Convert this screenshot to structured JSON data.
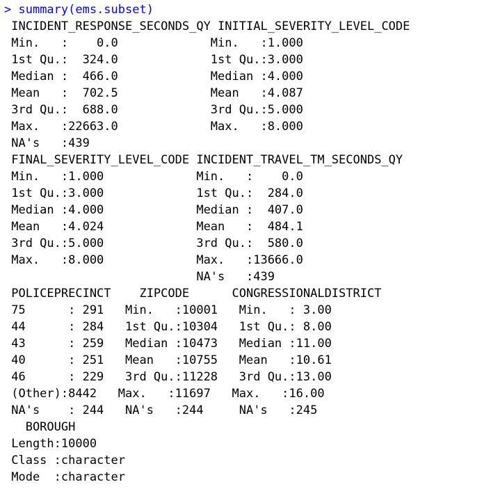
{
  "console": {
    "prompt": "> ",
    "command": "summary(ems.subset)",
    "colors": {
      "command": "#0000ff",
      "output": "#000000",
      "background": "#ffffff"
    },
    "output_lines": [
      " INCIDENT_RESPONSE_SECONDS_QY INITIAL_SEVERITY_LEVEL_CODE",
      " Min.   :    0.0             Min.   :1.000              ",
      " 1st Qu.:  324.0             1st Qu.:3.000              ",
      " Median :  466.0             Median :4.000              ",
      " Mean   :  702.5             Mean   :4.087              ",
      " 3rd Qu.:  688.0             3rd Qu.:5.000              ",
      " Max.   :22663.0             Max.   :8.000              ",
      " NA's   :439                                            ",
      " FINAL_SEVERITY_LEVEL_CODE INCIDENT_TRAVEL_TM_SECONDS_QY",
      " Min.   :1.000             Min.   :    0.0              ",
      " 1st Qu.:3.000             1st Qu.:  284.0              ",
      " Median :4.000             Median :  407.0              ",
      " Mean   :4.024             Mean   :  484.1              ",
      " 3rd Qu.:5.000             3rd Qu.:  580.0              ",
      " Max.   :8.000             Max.   :13666.0              ",
      "                           NA's   :439                  ",
      " POLICEPRECINCT    ZIPCODE      CONGRESSIONALDISTRICT",
      " 75      : 291   Min.   :10001   Min.   : 3.00        ",
      " 44      : 284   1st Qu.:10304   1st Qu.: 8.00        ",
      " 43      : 259   Median :10473   Median :11.00        ",
      " 40      : 251   Mean   :10755   Mean   :10.61        ",
      " 46      : 229   3rd Qu.:11228   3rd Qu.:13.00        ",
      " (Other):8442   Max.   :11697   Max.   :16.00        ",
      " NA's    : 244   NA's   :244     NA's   :245          ",
      "   BOROUGH         ",
      " Length:10000      ",
      " Class :character  ",
      " Mode  :character  "
    ]
  }
}
